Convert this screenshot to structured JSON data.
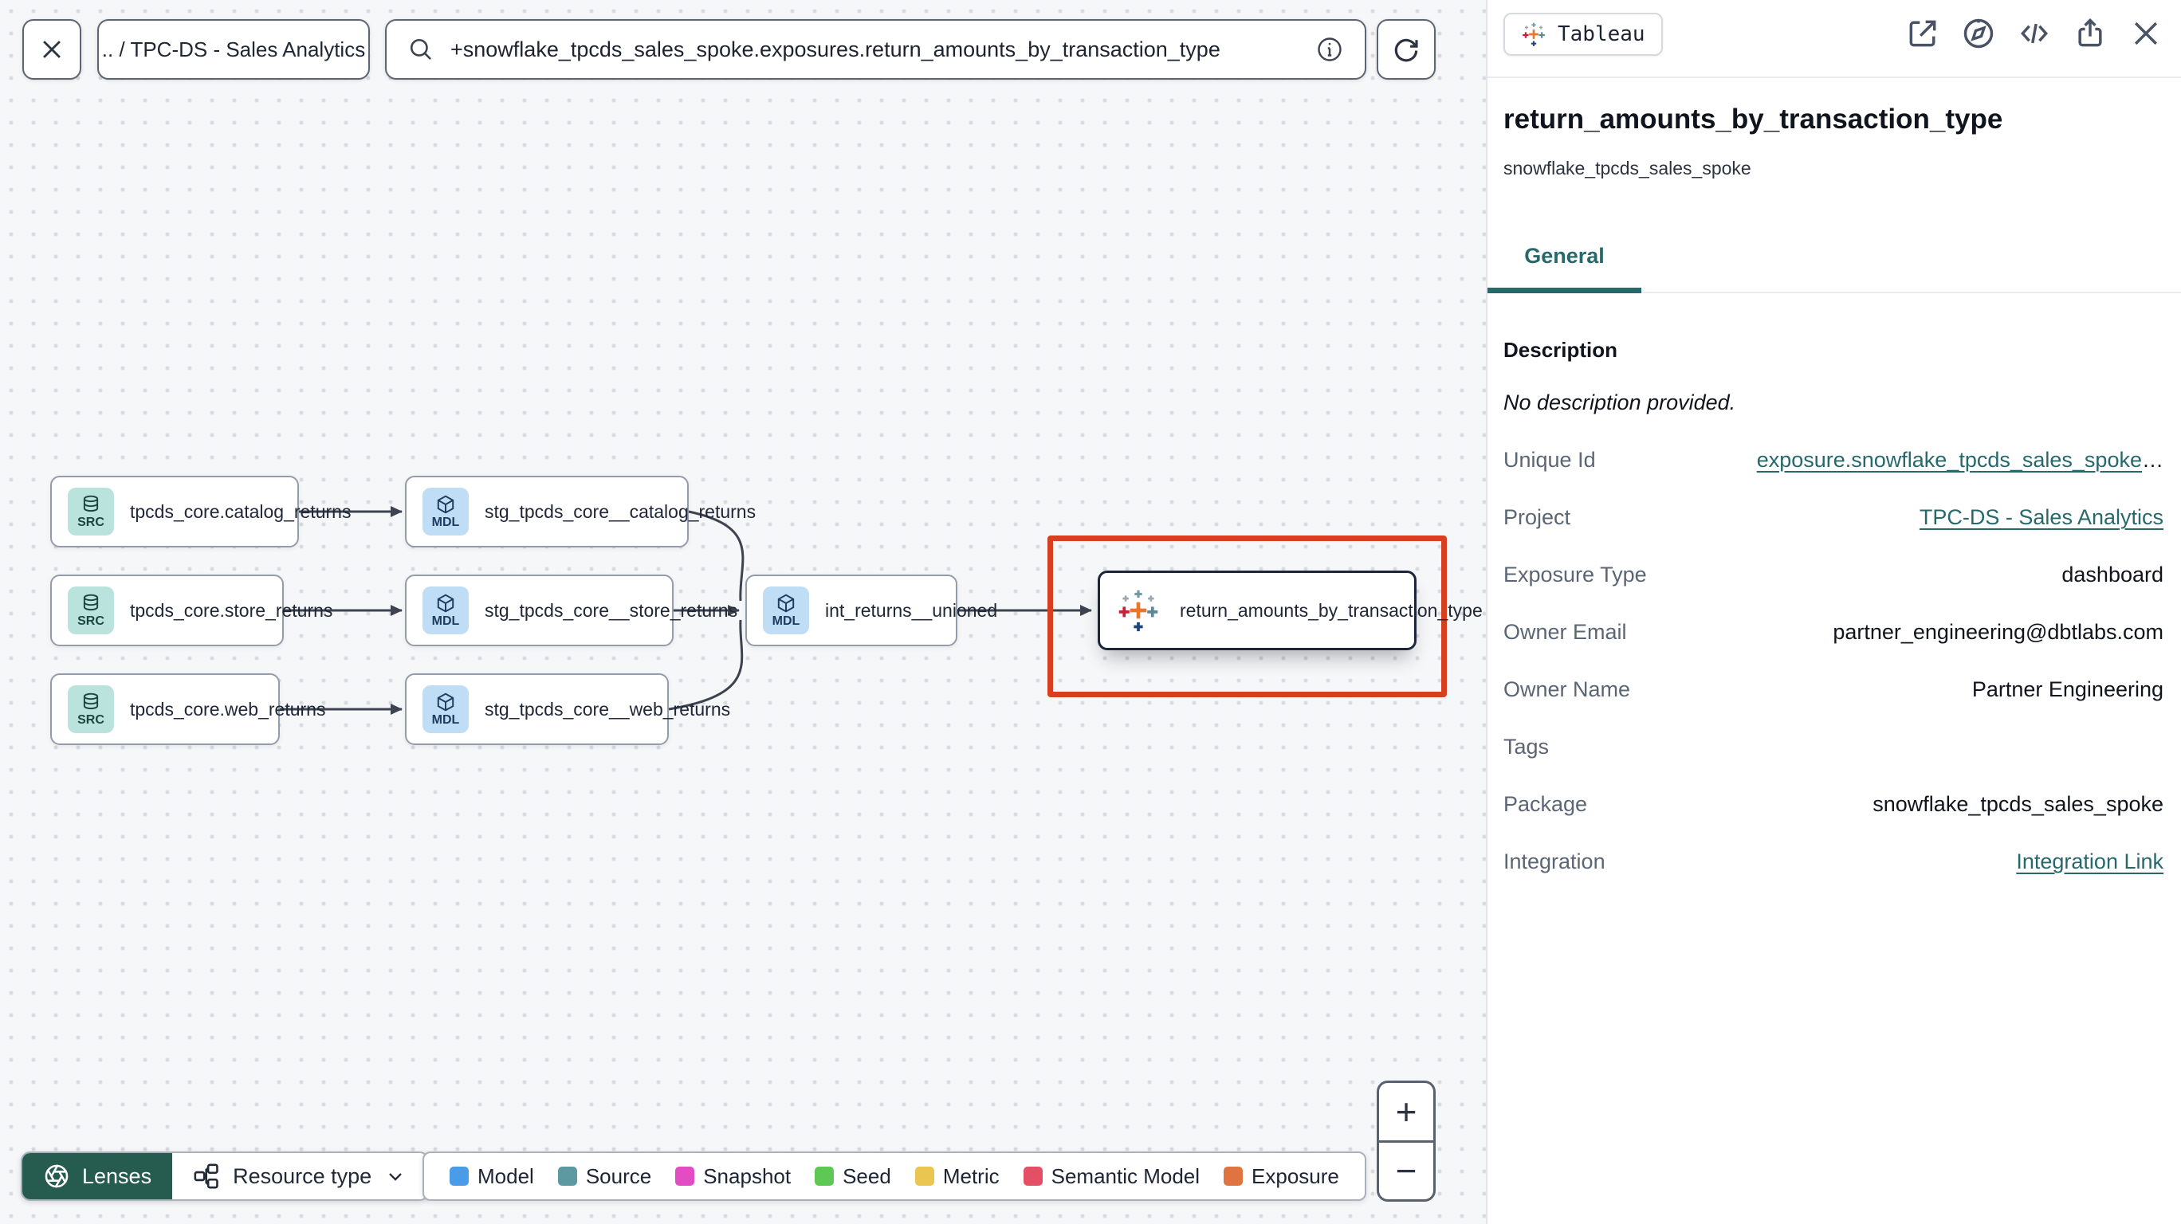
{
  "topbar": {
    "breadcrumb": ".. / TPC-DS - Sales Analytics",
    "search_value": "+snowflake_tpcds_sales_spoke.exposures.return_amounts_by_transaction_type"
  },
  "graph": {
    "nodes": [
      {
        "type": "source",
        "badge": "SRC",
        "label": "tpcds_core.catalog_returns"
      },
      {
        "type": "model",
        "badge": "MDL",
        "label": "stg_tpcds_core__catalog_returns"
      },
      {
        "type": "source",
        "badge": "SRC",
        "label": "tpcds_core.store_returns"
      },
      {
        "type": "model",
        "badge": "MDL",
        "label": "stg_tpcds_core__store_returns"
      },
      {
        "type": "source",
        "badge": "SRC",
        "label": "tpcds_core.web_returns"
      },
      {
        "type": "model",
        "badge": "MDL",
        "label": "stg_tpcds_core__web_returns"
      },
      {
        "type": "model",
        "badge": "MDL",
        "label": "int_returns__unioned"
      },
      {
        "type": "exposure",
        "icon": "tableau-logo-icon",
        "label": "return_amounts_by_transaction_type"
      }
    ]
  },
  "toolbar": {
    "lenses_label": "Lenses",
    "resource_type_label": "Resource type"
  },
  "legend": {
    "items": [
      {
        "label": "Model",
        "color": "#4b9ce8"
      },
      {
        "label": "Source",
        "color": "#5d99a1"
      },
      {
        "label": "Snapshot",
        "color": "#e44cc4"
      },
      {
        "label": "Seed",
        "color": "#5dc854"
      },
      {
        "label": "Metric",
        "color": "#eac54f"
      },
      {
        "label": "Semantic Model",
        "color": "#e44f66"
      },
      {
        "label": "Exposure",
        "color": "#df7440"
      }
    ]
  },
  "zoom_controls": {
    "zoom_in_label": "+",
    "zoom_out_label": "−"
  },
  "panel": {
    "integration_badge": "Tableau",
    "header_icons": [
      "open-in-new-icon",
      "explore-compass-icon",
      "code-icon",
      "share-icon",
      "close-icon"
    ],
    "title": "return_amounts_by_transaction_type",
    "subtitle": "snowflake_tpcds_sales_spoke",
    "active_tab": "General",
    "description_heading": "Description",
    "description_empty": "No description provided.",
    "fields": [
      {
        "label": "Unique Id",
        "value": "exposure.snowflake_tpcds_sales_spoke",
        "suffix": "…",
        "style": "link"
      },
      {
        "label": "Project",
        "value": "TPC-DS - Sales Analytics",
        "style": "link"
      },
      {
        "label": "Exposure Type",
        "value": "dashboard",
        "style": "text"
      },
      {
        "label": "Owner Email",
        "value": "partner_engineering@dbtlabs.com",
        "style": "text"
      },
      {
        "label": "Owner Name",
        "value": "Partner Engineering",
        "style": "text"
      },
      {
        "label": "Tags",
        "value": "",
        "style": "text"
      },
      {
        "label": "Package",
        "value": "snowflake_tpcds_sales_spoke",
        "style": "text"
      },
      {
        "label": "Integration",
        "value": "Integration Link",
        "style": "link"
      }
    ]
  },
  "colors": {
    "accent_teal": "#27696b",
    "selection_highlight_red": "#d6401f",
    "lenses_green": "#265c50"
  }
}
